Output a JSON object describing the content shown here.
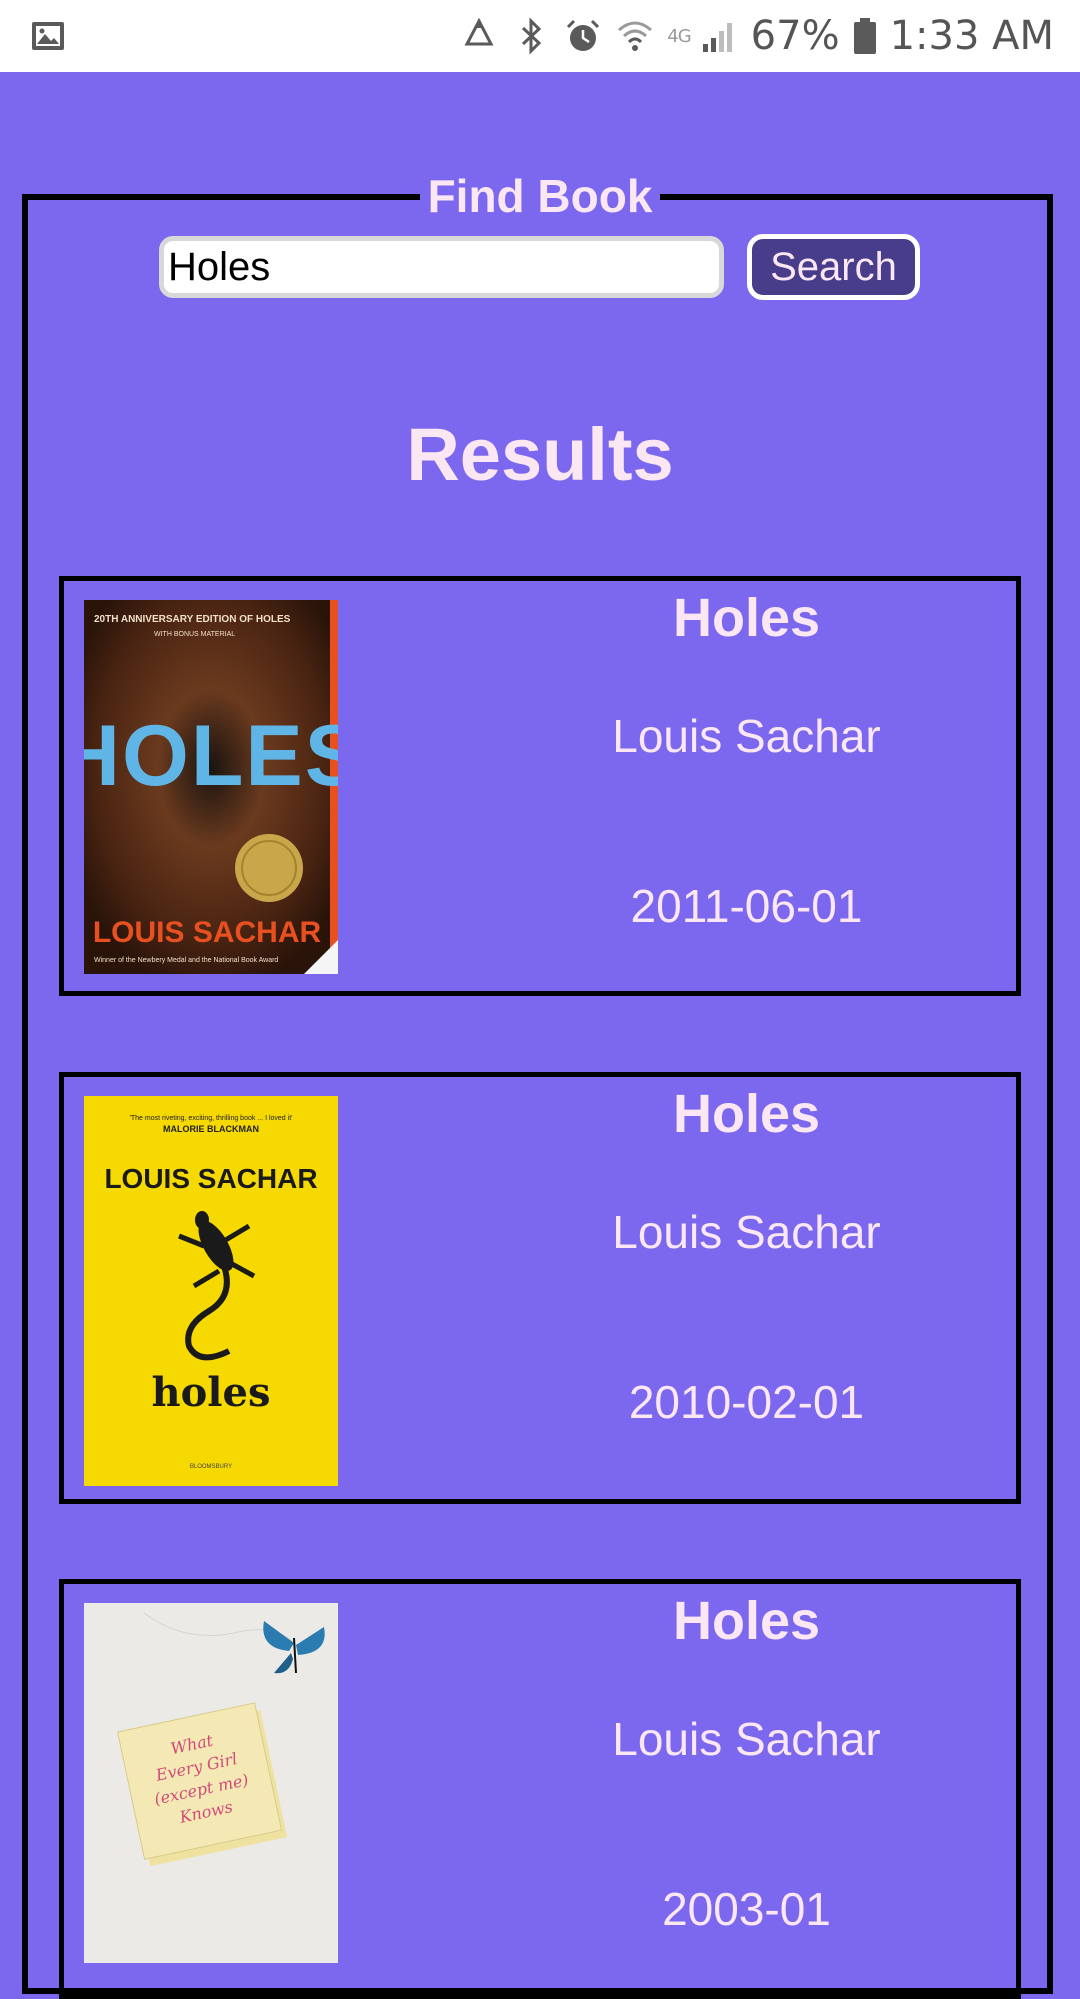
{
  "status_bar": {
    "battery": "67%",
    "time": "1:33 AM",
    "network": "4G",
    "icons": [
      "gallery-icon",
      "recycle-icon",
      "bluetooth-icon",
      "alarm-icon",
      "wifi-icon",
      "signal-icon",
      "battery-icon"
    ]
  },
  "search": {
    "legend": "Find Book",
    "value": "Holes",
    "placeholder": "",
    "button_label": "Search"
  },
  "results": {
    "heading": "Results",
    "items": [
      {
        "title": "Holes",
        "author": "Louis Sachar",
        "date": "2011-06-01",
        "cover_icon": "holes-anniversary-cover"
      },
      {
        "title": "Holes",
        "author": "Louis Sachar",
        "date": "2010-02-01",
        "cover_icon": "holes-yellow-lizard-cover"
      },
      {
        "title": "Holes",
        "author": "Louis Sachar",
        "date": "2003-01",
        "cover_icon": "what-every-girl-knows-cover"
      }
    ]
  },
  "covers": {
    "cover1": {
      "top_line": "20TH ANNIVERSARY EDITION OF HOLES",
      "sub_line": "WITH BONUS MATERIAL",
      "title": "HOLES",
      "author": "LOUIS SACHAR",
      "bottom_line": "Winner of the Newbery Medal and the National Book Award"
    },
    "cover2": {
      "quote": "'The most riveting, exciting, thrilling book ... I loved it'",
      "quote_by": "MALORIE BLACKMAN",
      "author": "LOUIS SACHAR",
      "title": "holes",
      "publisher": "BLOOMSBURY"
    },
    "cover3": {
      "note_l1": "What",
      "note_l2": "Every Girl",
      "note_l3": "(except me)",
      "note_l4": "Knows"
    }
  },
  "colors": {
    "background": "#7b68ee",
    "text": "#fbe7f3",
    "button": "#483d8b",
    "border": "#000000"
  }
}
